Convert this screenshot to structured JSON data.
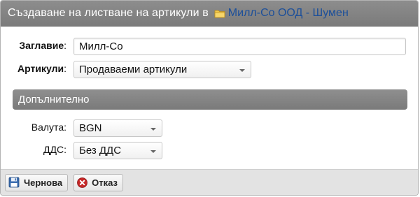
{
  "dialog": {
    "title": "Създаване на листване на артикули в",
    "folder_link": "Милл-Со ООД - Шумен"
  },
  "form": {
    "title_label": "Заглавие",
    "title_value": "Милл-Со",
    "articles_label": "Артикули",
    "articles_value": "Продаваеми артикули",
    "section_label": "Допълнително",
    "currency_label": "Валута:",
    "currency_value": "BGN",
    "vat_label": "ДДС:",
    "vat_value": "Без ДДС"
  },
  "footer": {
    "draft_label": "Чернова",
    "cancel_label": "Отказ"
  },
  "colors": {
    "title_bar": "#838383",
    "link": "#1c4f9a",
    "section_bar": "#858585",
    "cancel_icon": "#c62828",
    "draft_icon": "#3d6fb0"
  },
  "icons": [
    "folder-icon",
    "save-icon",
    "cancel-icon",
    "chevron-down-icon"
  ]
}
